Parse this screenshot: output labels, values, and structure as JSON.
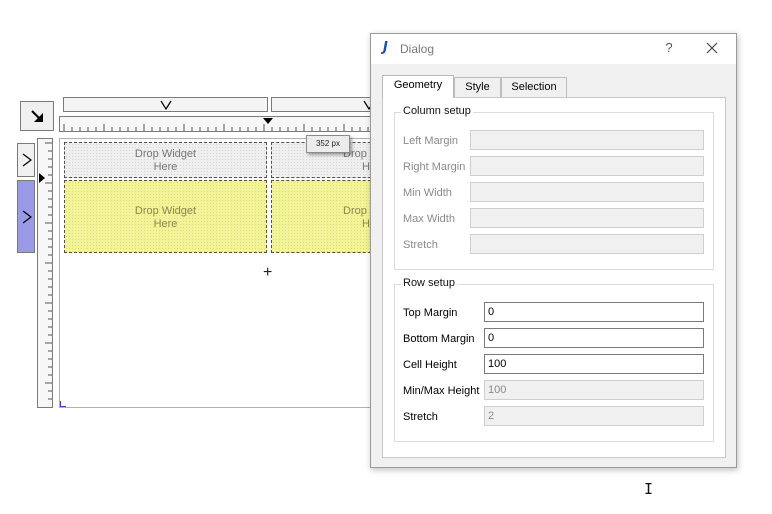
{
  "editor": {
    "cells": [
      {
        "line1": "Drop Widget",
        "line2": "Here"
      },
      {
        "line1": "Drop W",
        "line2": "He"
      },
      {
        "line1": "Drop Widget",
        "line2": "Here"
      },
      {
        "line1": "Drop W",
        "line2": "He"
      }
    ],
    "ruler_tooltip": "352 px",
    "add_symbol": "+"
  },
  "dialog": {
    "title": "Dialog",
    "help": "?",
    "tabs": [
      "Geometry",
      "Style",
      "Selection"
    ],
    "active_tab": "Geometry",
    "column_setup": {
      "title": "Column setup",
      "fields": [
        {
          "label": "Left Margin",
          "value": ""
        },
        {
          "label": "Right Margin",
          "value": ""
        },
        {
          "label": "Min Width",
          "value": ""
        },
        {
          "label": "Max Width",
          "value": ""
        },
        {
          "label": "Stretch",
          "value": ""
        }
      ]
    },
    "row_setup": {
      "title": "Row setup",
      "fields": [
        {
          "label": "Top Margin",
          "value": "0"
        },
        {
          "label": "Bottom Margin",
          "value": "0"
        },
        {
          "label": "Cell Height",
          "value": "100"
        },
        {
          "label": "Min/Max Height",
          "value": "100"
        },
        {
          "label": "Stretch",
          "value": "2"
        }
      ]
    }
  },
  "colors": {
    "row_header_selected": "#9a9ae6",
    "cell_highlight": "#f3f39a",
    "app_icon": "#1f4fa8"
  }
}
